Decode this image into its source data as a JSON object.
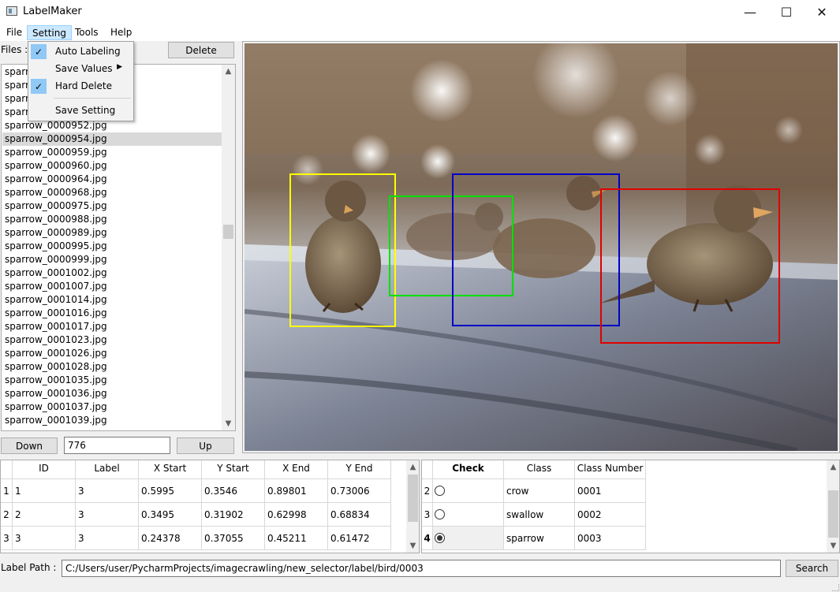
{
  "window": {
    "title": "LabelMaker",
    "controls": {
      "minimize": "—",
      "maximize": "☐",
      "close": "✕"
    }
  },
  "menubar": {
    "items": [
      {
        "label": "File"
      },
      {
        "label": "Setting",
        "active": true
      },
      {
        "label": "Tools"
      },
      {
        "label": "Help"
      }
    ]
  },
  "setting_menu": {
    "auto_labeling": "Auto Labeling",
    "save_values": "Save Values",
    "hard_delete": "Hard Delete",
    "save_setting": "Save Setting",
    "check_glyph": "✓",
    "submenu_glyph": "▶"
  },
  "files": {
    "label": "Files :",
    "delete_button": "Delete",
    "hidden_items": [
      "sparro",
      "sparro",
      "sparro",
      "sparro"
    ],
    "items": [
      "sparrow_0000952.jpg",
      "sparrow_0000954.jpg",
      "sparrow_0000959.jpg",
      "sparrow_0000960.jpg",
      "sparrow_0000964.jpg",
      "sparrow_0000968.jpg",
      "sparrow_0000975.jpg",
      "sparrow_0000988.jpg",
      "sparrow_0000989.jpg",
      "sparrow_0000995.jpg",
      "sparrow_0000999.jpg",
      "sparrow_0001002.jpg",
      "sparrow_0001007.jpg",
      "sparrow_0001014.jpg",
      "sparrow_0001016.jpg",
      "sparrow_0001017.jpg",
      "sparrow_0001023.jpg",
      "sparrow_0001026.jpg",
      "sparrow_0001028.jpg",
      "sparrow_0001035.jpg",
      "sparrow_0001036.jpg",
      "sparrow_0001037.jpg",
      "sparrow_0001039.jpg"
    ],
    "selected": "sparrow_0000954.jpg"
  },
  "nav": {
    "down_button": "Down",
    "index_value": "776",
    "up_button": "Up"
  },
  "labels_table": {
    "columns": [
      "ID",
      "Label",
      "X Start",
      "Y Start",
      "X End",
      "Y End"
    ],
    "rows": [
      {
        "num": "1",
        "cells": [
          "1",
          "3",
          "0.5995",
          "0.3546",
          "0.89801",
          "0.73006"
        ]
      },
      {
        "num": "2",
        "cells": [
          "2",
          "3",
          "0.3495",
          "0.31902",
          "0.62998",
          "0.68834"
        ]
      },
      {
        "num": "3",
        "cells": [
          "3",
          "3",
          "0.24378",
          "0.37055",
          "0.45211",
          "0.61472"
        ]
      }
    ]
  },
  "class_table": {
    "columns": [
      "Check",
      "Class",
      "Class Number"
    ],
    "rows": [
      {
        "num": "2",
        "checked": false,
        "class": "crow",
        "number": "0001"
      },
      {
        "num": "3",
        "checked": false,
        "class": "swallow",
        "number": "0002"
      },
      {
        "num": "4",
        "checked": true,
        "class": "sparrow",
        "number": "0003"
      }
    ]
  },
  "footer": {
    "label_path_label": "Label Path :",
    "label_path_value": "C:/Users/user/PycharmProjects/imagecrawling/new_selector/label/bird/0003",
    "search_button": "Search"
  },
  "boxes": [
    {
      "label": "bird",
      "color": "#ffff00"
    },
    {
      "label": "bird",
      "color": "#00e000"
    },
    {
      "label": "bird",
      "color": "#0000c8"
    },
    {
      "label": "bird",
      "color": "#e00000"
    }
  ],
  "scroll_arrows": {
    "up": "▲",
    "down": "▼"
  }
}
